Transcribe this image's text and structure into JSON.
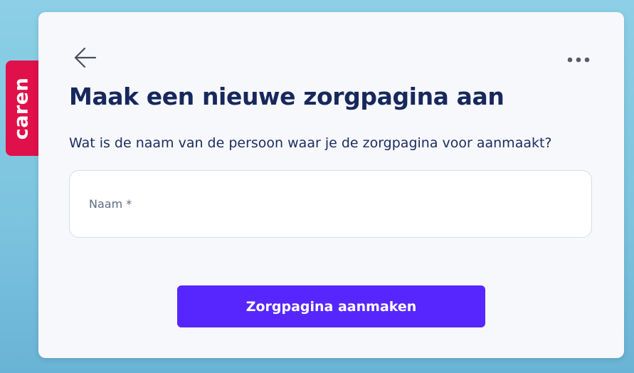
{
  "brand": {
    "name": "caren",
    "color": "#e0104a"
  },
  "header": {
    "back_icon": "arrow-left-icon",
    "more_icon": "more-horizontal-icon"
  },
  "main": {
    "title": "Maak een nieuwe zorgpagina aan",
    "question": "Wat is de naam van de persoon waar je de zorgpagina voor aanmaakt?",
    "name_field": {
      "placeholder": "Naam *",
      "value": ""
    },
    "submit_label": "Zorgpagina aanmaken"
  },
  "colors": {
    "accent": "#5726ff",
    "title": "#17285c",
    "card_background": "#f7f8fc"
  }
}
